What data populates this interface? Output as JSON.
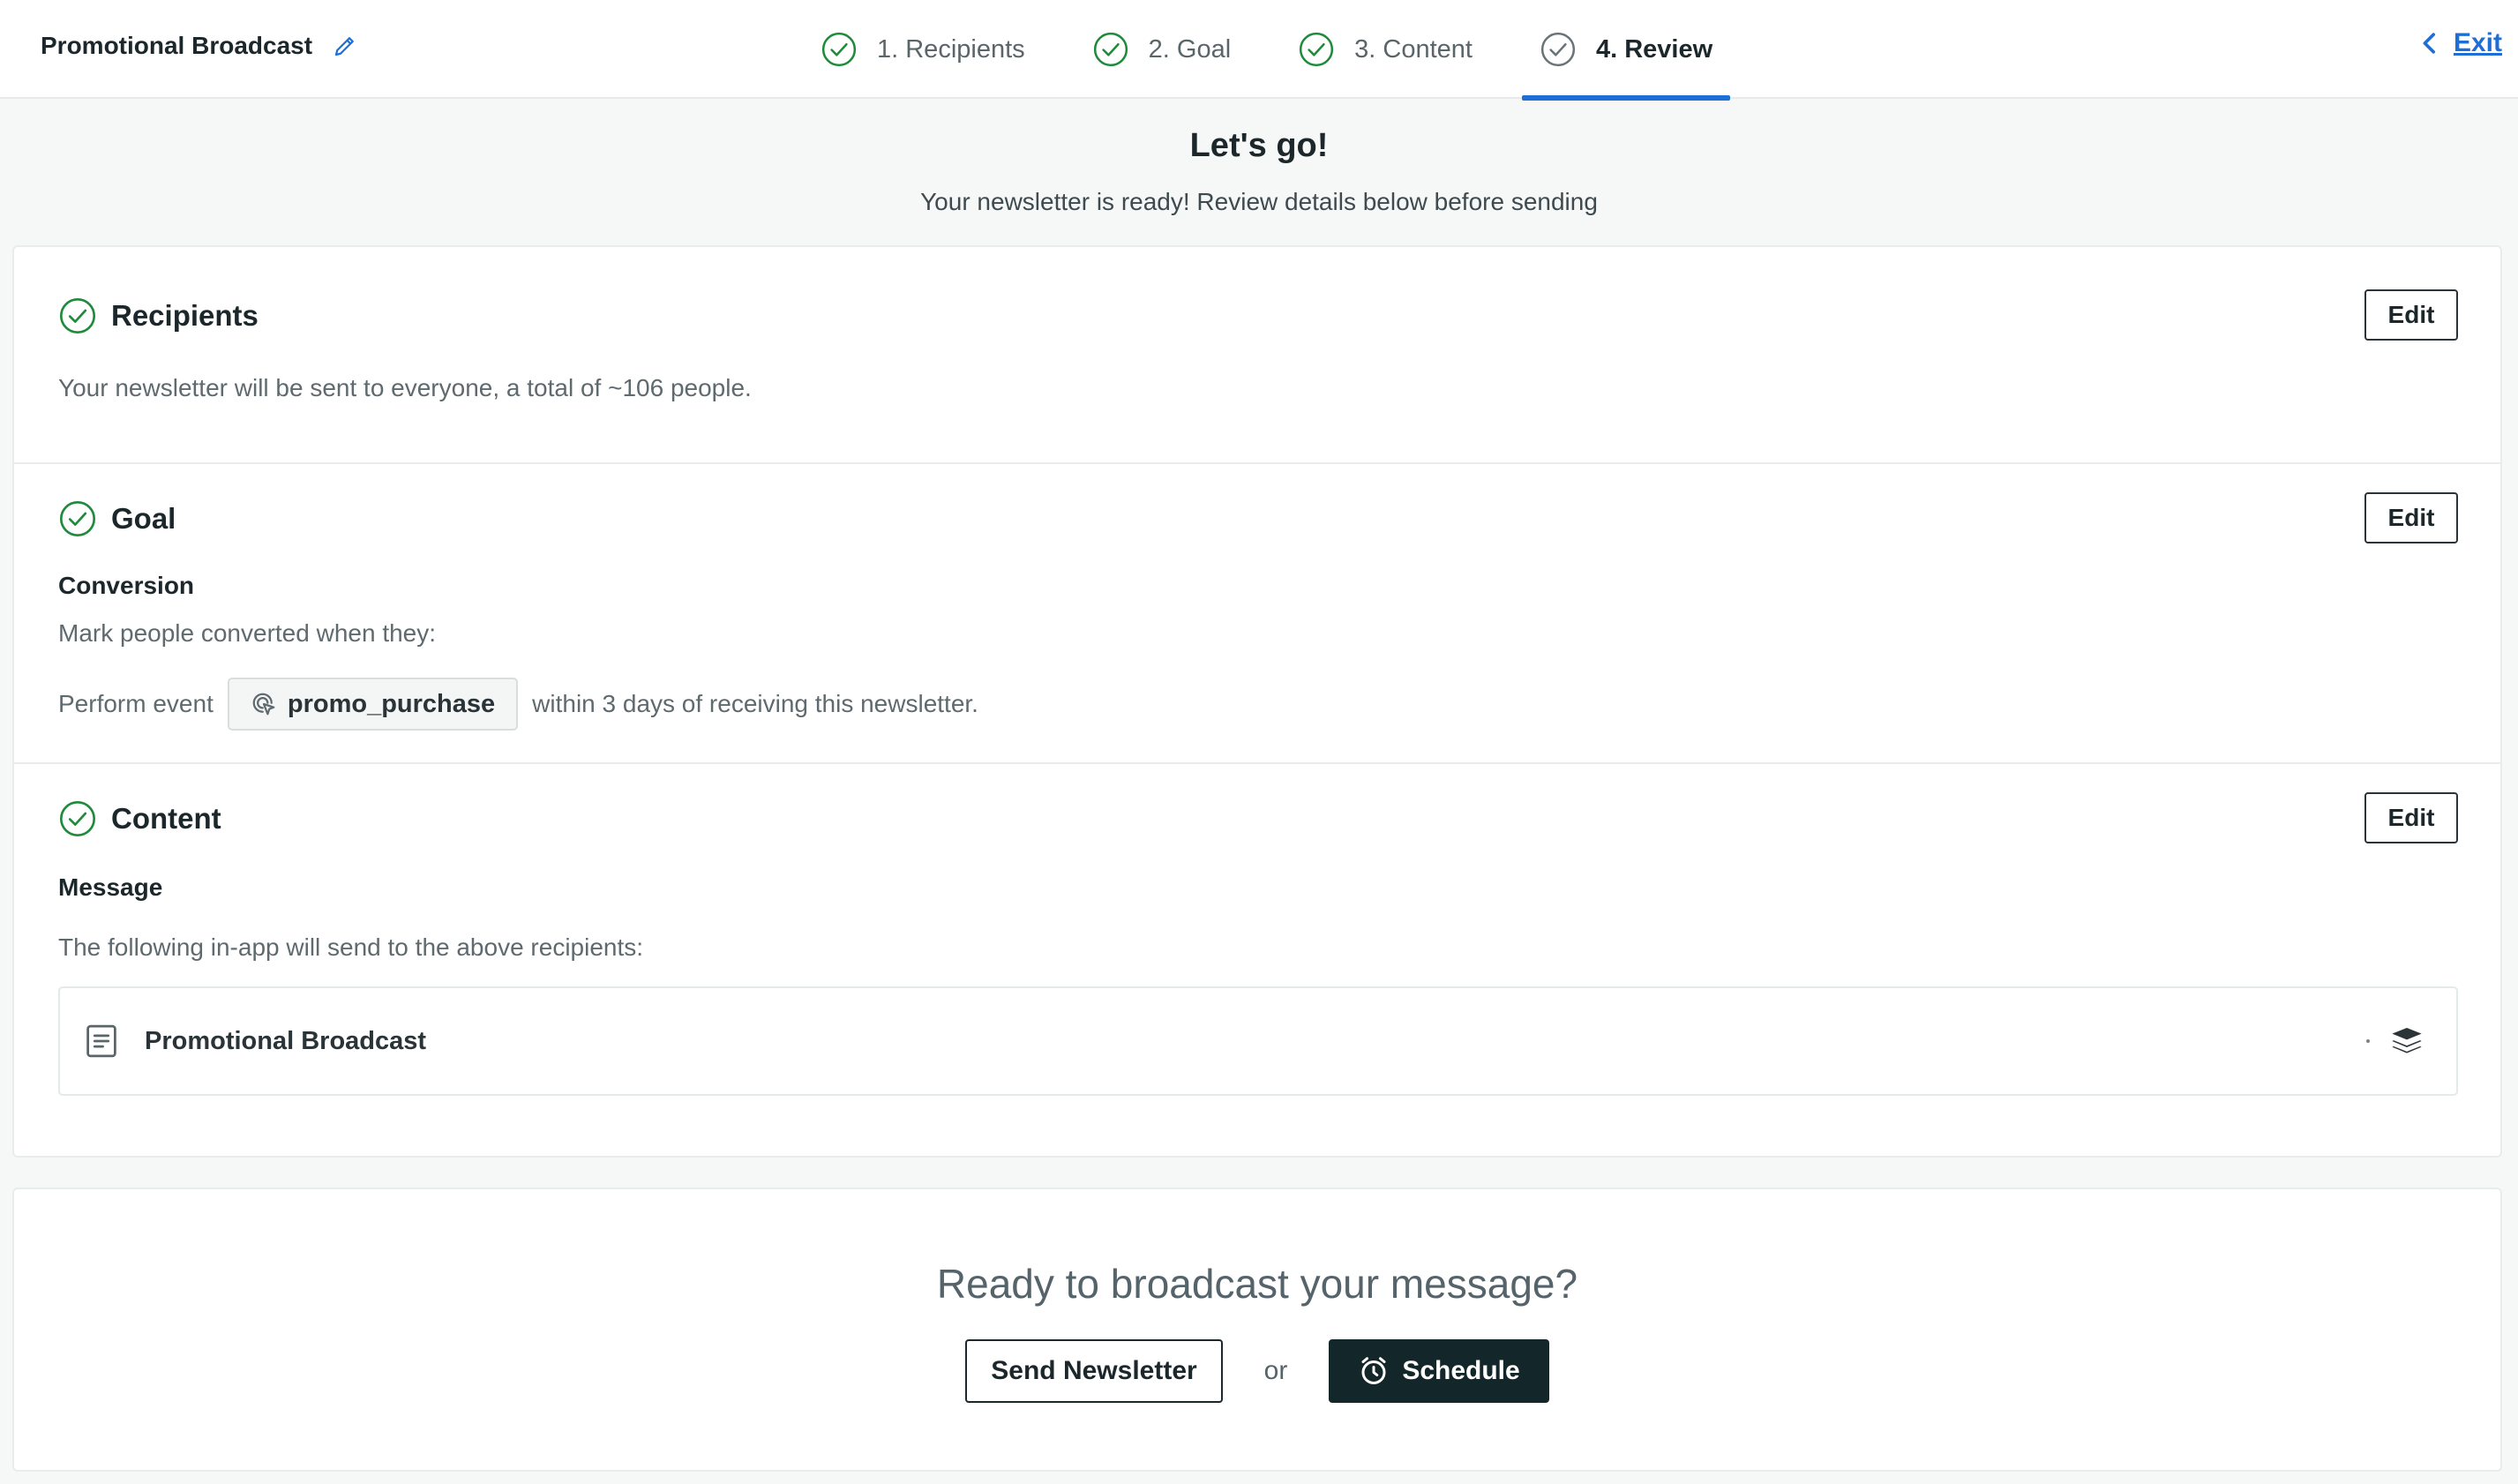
{
  "header": {
    "campaign_name": "Promotional Broadcast",
    "steps": [
      {
        "label": "1. Recipients",
        "state": "complete"
      },
      {
        "label": "2. Goal",
        "state": "complete"
      },
      {
        "label": "3. Content",
        "state": "complete"
      },
      {
        "label": "4. Review",
        "state": "active"
      }
    ],
    "exit_label": "Exit"
  },
  "intro": {
    "title": "Let's go!",
    "subtitle": "Your newsletter is ready! Review details below before sending"
  },
  "recipients": {
    "title": "Recipients",
    "edit_label": "Edit",
    "description": "Your newsletter will be sent to everyone, a total of ~106 people."
  },
  "goal": {
    "title": "Goal",
    "edit_label": "Edit",
    "subheading": "Conversion",
    "description": "Mark people converted when they:",
    "event_prefix": "Perform event",
    "event_name": "promo_purchase",
    "event_suffix": "within 3 days of receiving this newsletter."
  },
  "content": {
    "title": "Content",
    "edit_label": "Edit",
    "subheading": "Message",
    "description": "The following in-app will send to the above recipients:",
    "message_name": "Promotional Broadcast"
  },
  "footer": {
    "prompt": "Ready to broadcast your message?",
    "send_label": "Send Newsletter",
    "or_label": "or",
    "schedule_label": "Schedule"
  },
  "colors": {
    "accent": "#1d6fd6",
    "success": "#1e8a3a",
    "dark_button": "#13262a"
  }
}
